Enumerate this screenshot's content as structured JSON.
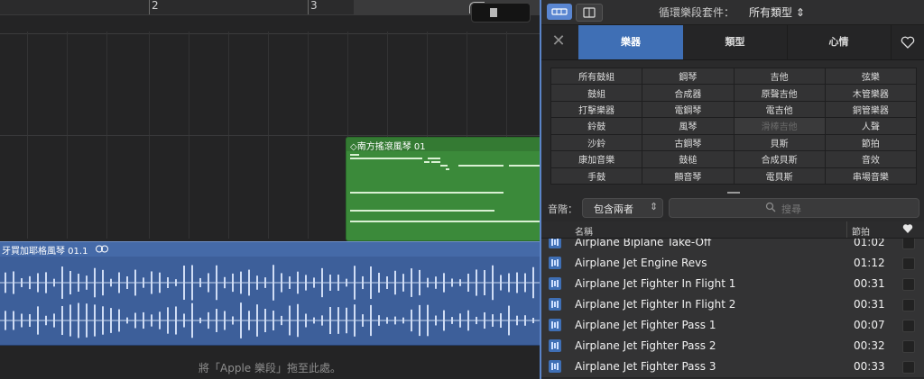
{
  "timeline": {
    "bar_numbers": [
      "2",
      "3"
    ]
  },
  "regions": {
    "midi_title": "南方搖滾風琴 01",
    "audio_title": "牙買加耶格風琴 01.1"
  },
  "drop_hint": "將「Apple 樂段」拖至此處。",
  "browser": {
    "loop_pack_label": "循環樂段套件：",
    "loop_pack_value": "所有類型",
    "tabs": {
      "instrument": "樂器",
      "genre": "類型",
      "mood": "心情"
    },
    "keywords": [
      "所有鼓組",
      "鋼琴",
      "吉他",
      "弦樂",
      "鼓組",
      "合成器",
      "原聲吉他",
      "木管樂器",
      "打擊樂器",
      "電鋼琴",
      "電吉他",
      "銅管樂器",
      "鈴鼓",
      "風琴",
      "滑棒吉他",
      "人聲",
      "沙鈴",
      "古鋼琴",
      "貝斯",
      "節拍",
      "康加音樂",
      "鼓槌",
      "合成貝斯",
      "音效",
      "手鼓",
      "顫音琴",
      "電貝斯",
      "串場音樂"
    ],
    "scale_label": "音階：",
    "scale_value": "包含兩者",
    "search_placeholder": "搜尋",
    "columns": {
      "name": "名稱",
      "beats": "節拍"
    },
    "loops": [
      {
        "name": "Airplane Biplane Take-Off",
        "beats": "01:02"
      },
      {
        "name": "Airplane Jet Engine Revs",
        "beats": "01:12"
      },
      {
        "name": "Airplane Jet Fighter In Flight 1",
        "beats": "00:31"
      },
      {
        "name": "Airplane Jet Fighter In Flight 2",
        "beats": "00:31"
      },
      {
        "name": "Airplane Jet Fighter Pass 1",
        "beats": "00:07"
      },
      {
        "name": "Airplane Jet Fighter Pass 2",
        "beats": "00:32"
      },
      {
        "name": "Airplane Jet Fighter Pass 3",
        "beats": "00:33"
      }
    ]
  }
}
